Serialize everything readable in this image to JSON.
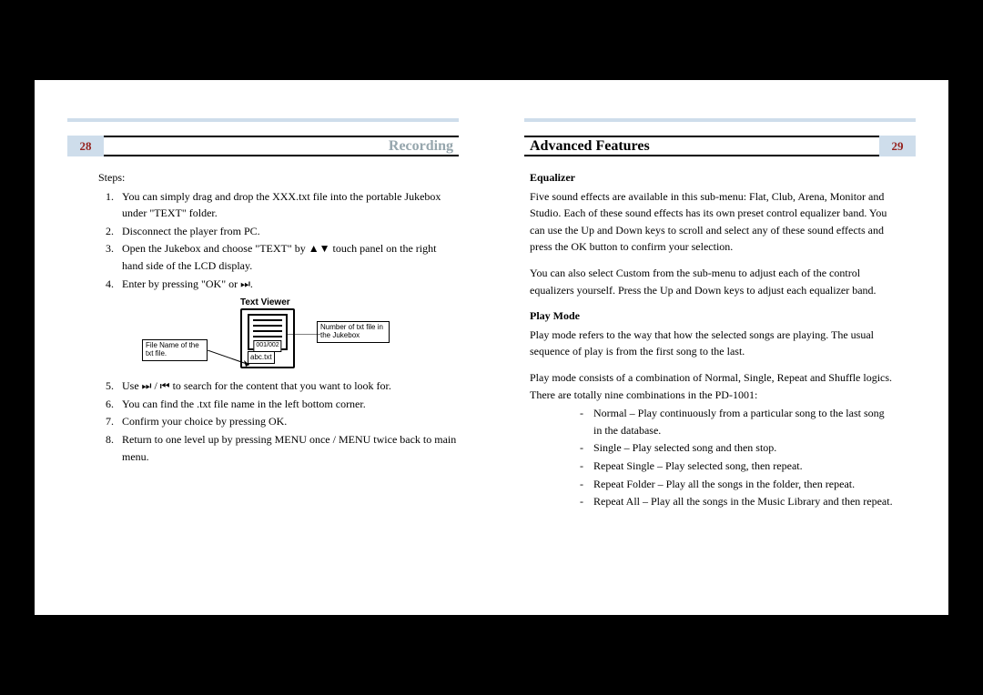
{
  "left": {
    "page_num": "28",
    "section": "Recording",
    "steps_label": "Steps:",
    "steps": [
      "You can simply drag and drop the XXX.txt file into the portable Jukebox under \"TEXT\" folder.",
      "Disconnect the player from PC.",
      "Open the Jukebox and choose \"TEXT\" by ▲▼ touch panel on the right hand side of the LCD display.",
      "Enter by pressing \"OK\" or ⏭.",
      "Use ⏭ / ⏮ to search for the content that you want to look for.",
      "You can find the .txt file name in the left bottom corner.",
      "Confirm your choice by pressing OK.",
      "Return to one level up by pressing MENU once / MENU twice back to main menu."
    ],
    "diagram": {
      "title": "Text Viewer",
      "count": "001/002",
      "file": "abc.txt",
      "callout_left": "File Name of the txt file.",
      "callout_right": "Number of txt file in the Jukebox"
    }
  },
  "right": {
    "page_num": "29",
    "section": "Advanced Features",
    "eq_h": "Equalizer",
    "eq_p1": "Five sound effects are available in this sub-menu: Flat, Club, Arena, Monitor and Studio.  Each of these sound effects has its own preset control equalizer band.  You can use the Up and Down keys to scroll and select any of these sound effects and press the OK button to confirm your selection.",
    "eq_p2": "You can also select Custom from the sub-menu to adjust each of the control equalizers yourself.  Press the Up and Down keys to adjust each  equalizer band.",
    "pm_h": "Play Mode",
    "pm_p1": "Play mode refers to the way that how the selected songs are playing.  The usual sequence of play is from the first song to the last.",
    "pm_p2": "Play mode consists of a combination of Normal, Single, Repeat and Shuffle logics.   There are totally nine combinations in the PD-1001:",
    "modes": [
      "Normal – Play continuously from a particular song to the last song in the database.",
      "Single – Play selected song and then stop.",
      "Repeat Single – Play selected song, then repeat.",
      "Repeat Folder – Play all the songs in the folder, then repeat.",
      "Repeat All – Play all the songs in the Music Library and then repeat."
    ]
  }
}
